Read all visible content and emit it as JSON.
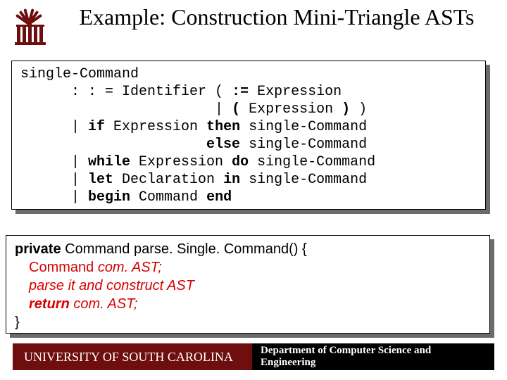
{
  "title": "Example: Construction Mini-Triangle ASTs",
  "grammar": {
    "l1": "single-Command",
    "l2a": "      : : = Identifier ( ",
    "l2b": ":=",
    "l2c": " Expression",
    "l3a": "                       | ",
    "l3b": "(",
    "l3c": " Expression ",
    "l3d": ")",
    "l3e": " )",
    "l4a": "      | ",
    "l4b": "if",
    "l4c": " Expression ",
    "l4d": "then",
    "l4e": " single-Command",
    "l5a": "                      ",
    "l5b": "else",
    "l5c": " single-Command",
    "l6a": "      | ",
    "l6b": "while",
    "l6c": " Expression ",
    "l6d": "do",
    "l6e": " single-Command",
    "l7a": "      | ",
    "l7b": "let",
    "l7c": " Declaration ",
    "l7d": "in",
    "l7e": " single-Command",
    "l8a": "      | ",
    "l8b": "begin",
    "l8c": " Command ",
    "l8d": "end"
  },
  "java": {
    "l1_kw": "private",
    "l1_rest": " Command parse. Single. Command() {",
    "l2_type": "Command ",
    "l2_var": "com. AST;",
    "l3": "parse it and construct AST",
    "l4_kw": "return",
    "l4_rest": " com. AST;",
    "l5": "}"
  },
  "footer": {
    "university": "UNIVERSITY OF SOUTH CAROLINA",
    "department": "Department of Computer Science and Engineering"
  }
}
